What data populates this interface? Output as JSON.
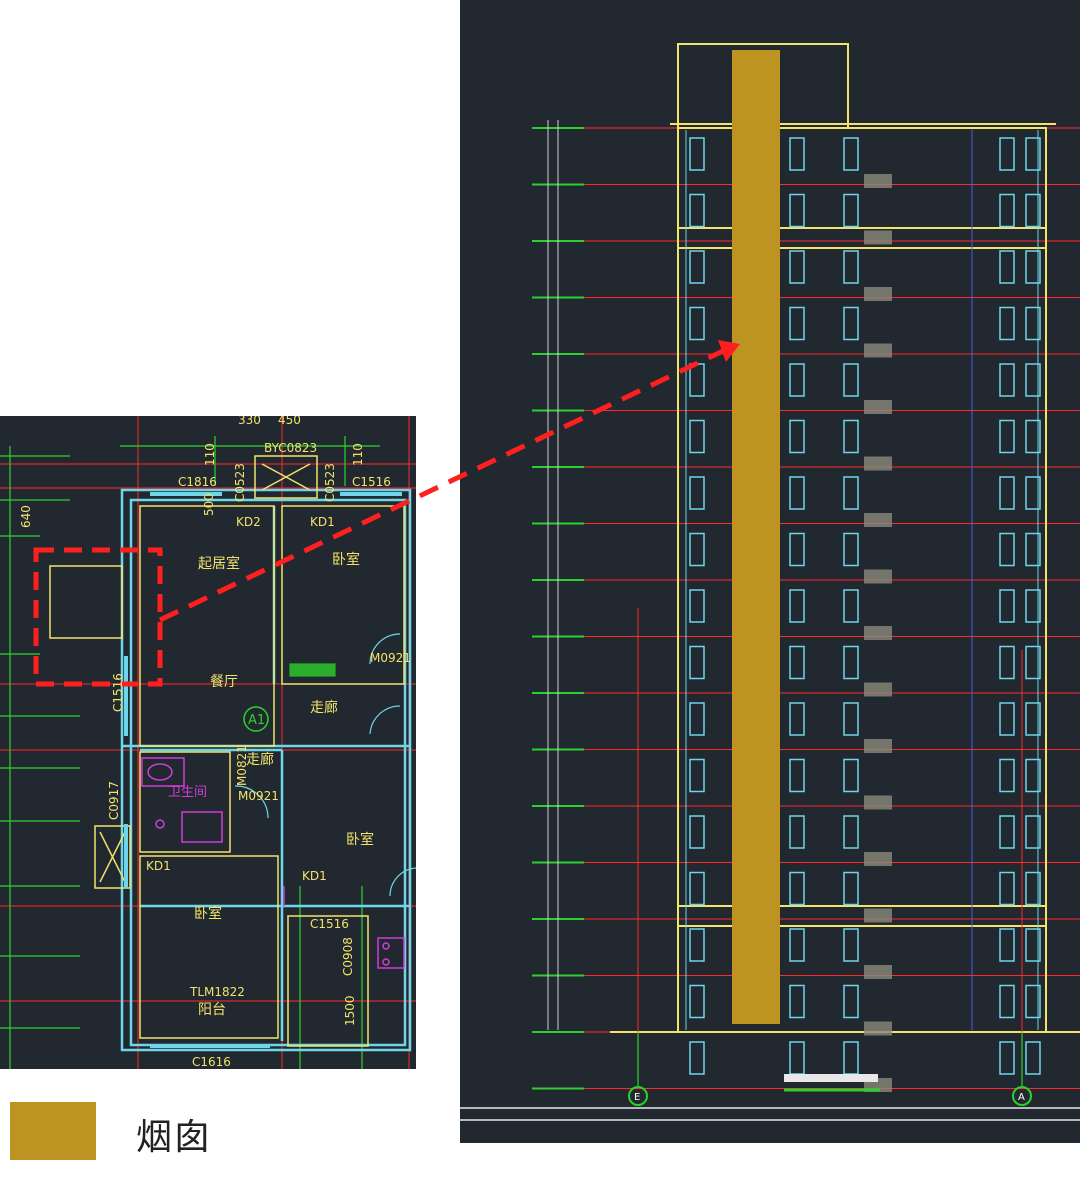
{
  "colors": {
    "background": "#212830",
    "wall": "#6fd6ea",
    "grid": "#ff2a2a",
    "dimension": "#2dd12d",
    "annotation": "#f2e36a",
    "sanitary": "#d13cd6",
    "chimney": "#bd9322",
    "highlight": "#ff1f1f"
  },
  "plan": {
    "dimensions": {
      "top_left": "330",
      "top_right": "450",
      "side_left": "640",
      "left_110": "110",
      "right_110": "110",
      "mid_500": "500",
      "bottom_1500": "1500"
    },
    "windows": {
      "c1816": "C1816",
      "byc0823": "BYC0823",
      "c0523": "C0523",
      "c0523b": "C0523",
      "c1516": "C1516",
      "c1516_left": "C1516",
      "c1616": "C1616",
      "c1516_small": "C1516",
      "c0917": "C0917",
      "tlm1822": "TLM1822"
    },
    "doors": {
      "kd2": "KD2",
      "kd1_a": "KD1",
      "kd1_b": "KD1",
      "kd1_c": "KD1",
      "m0921_a": "M0921",
      "m0921_b": "M0921",
      "m0821": "M0821",
      "c0908": "C0908"
    },
    "rooms": {
      "living": "起居室",
      "bedroom_a": "卧室",
      "dining": "餐厅",
      "corridor_a": "走廊",
      "corridor_b": "走廊",
      "bathroom": "卫生间",
      "bedroom_b": "卧室",
      "bedroom_c": "卧室",
      "balcony": "阳台"
    },
    "axis_tag": "A1"
  },
  "elevation": {
    "axis_left": "E",
    "axis_right": "A"
  },
  "legend": {
    "label": "烟囱",
    "swatch_color": "#bd9322"
  }
}
